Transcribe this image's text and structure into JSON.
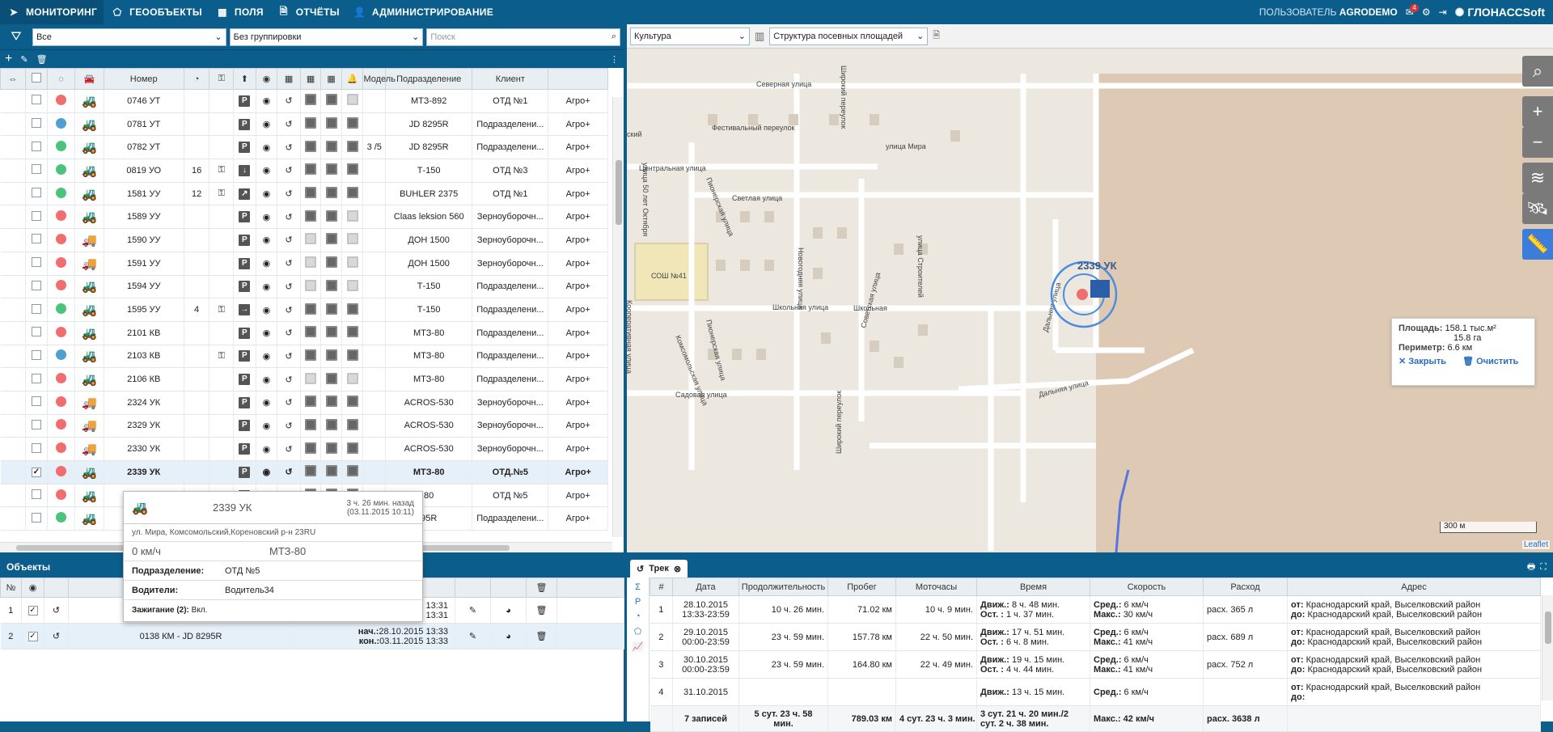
{
  "nav": {
    "items": [
      {
        "label": "МОНИТОРИНГ",
        "icon": "navigation-arrow-icon",
        "active": true
      },
      {
        "label": "ГЕООБЪЕКТЫ",
        "icon": "pentagon-icon"
      },
      {
        "label": "ПОЛЯ",
        "icon": "grid-icon"
      },
      {
        "label": "ОТЧЁТЫ",
        "icon": "document-icon"
      },
      {
        "label": "АДМИНИСТРИРОВАНИЕ",
        "icon": "user-admin-icon"
      }
    ],
    "user_prefix": "ПОЛЬЗОВАТЕЛЬ",
    "user_name": "AGRODEMO",
    "mail_badge": "4",
    "logo": "ГЛОНАССSoft"
  },
  "filters": {
    "status": "Все",
    "grouping": "Без группировки",
    "search_placeholder": "Поиск"
  },
  "columns": {
    "number": "Номер",
    "model": "Модель",
    "division": "Подразделение",
    "client": "Клиент"
  },
  "vehicles": [
    {
      "check": "",
      "color": "#f26d6d",
      "num": "0746 УТ",
      "speed": "",
      "key": "",
      "dir": "P",
      "eye": true,
      "s1": "d",
      "s2": "d",
      "s3": "l",
      "extra": "",
      "model": "МТЗ-892",
      "div": "ОТД №1",
      "client": "Агро+",
      "type": "tractor"
    },
    {
      "check": "",
      "color": "#4f9fd1",
      "num": "0781 УТ",
      "speed": "",
      "key": "",
      "dir": "P",
      "eye": true,
      "s1": "d",
      "s2": "d",
      "s3": "d",
      "extra": "",
      "model": "JD 8295R",
      "div": "Подразделени...",
      "client": "Агро+",
      "type": "tractor"
    },
    {
      "check": "",
      "color": "#4cc37b",
      "num": "0782 УТ",
      "speed": "",
      "key": "",
      "dir": "P",
      "eye": true,
      "s1": "d",
      "s2": "d",
      "s3": "d",
      "extra": "3 /5",
      "model": "JD 8295R",
      "div": "Подразделени...",
      "client": "Агро+",
      "type": "tractor"
    },
    {
      "check": "",
      "color": "#4cc37b",
      "num": "0819 УО",
      "speed": "16",
      "key": "k",
      "dir": "↓",
      "eye": true,
      "s1": "d",
      "s2": "d",
      "s3": "d",
      "extra": "",
      "model": "Т-150",
      "div": "ОТД №3",
      "client": "Агро+",
      "type": "tractor"
    },
    {
      "check": "",
      "color": "#4cc37b",
      "num": "1581 УУ",
      "speed": "12",
      "key": "k",
      "dir": "↗",
      "eye": true,
      "s1": "d",
      "s2": "d",
      "s3": "d",
      "extra": "",
      "model": "BUHLER 2375",
      "div": "ОТД №1",
      "client": "Агро+",
      "type": "tractor"
    },
    {
      "check": "",
      "color": "#f26d6d",
      "num": "1589 УУ",
      "speed": "",
      "key": "",
      "dir": "P",
      "eye": true,
      "s1": "d",
      "s2": "d",
      "s3": "l",
      "extra": "",
      "model": "Claas leksion 560",
      "div": "Зерноуборочн...",
      "client": "Агро+",
      "type": "combine"
    },
    {
      "check": "",
      "color": "#f26d6d",
      "num": "1590 УУ",
      "speed": "",
      "key": "",
      "dir": "P",
      "eye": true,
      "s1": "l",
      "s2": "d",
      "s3": "l",
      "extra": "",
      "model": "ДОН 1500",
      "div": "Зерноуборочн...",
      "client": "Агро+",
      "type": "truck"
    },
    {
      "check": "",
      "color": "#f26d6d",
      "num": "1591 УУ",
      "speed": "",
      "key": "",
      "dir": "P",
      "eye": true,
      "s1": "l",
      "s2": "d",
      "s3": "l",
      "extra": "",
      "model": "ДОН 1500",
      "div": "Зерноуборочн...",
      "client": "Агро+",
      "type": "truck"
    },
    {
      "check": "",
      "color": "#f26d6d",
      "num": "1594 УУ",
      "speed": "",
      "key": "",
      "dir": "P",
      "eye": true,
      "s1": "l",
      "s2": "d",
      "s3": "l",
      "extra": "",
      "model": "Т-150",
      "div": "Подразделени...",
      "client": "Агро+",
      "type": "tractor"
    },
    {
      "check": "",
      "color": "#4cc37b",
      "num": "1595 УУ",
      "speed": "4",
      "key": "k",
      "dir": "→",
      "eye": true,
      "s1": "d",
      "s2": "d",
      "s3": "d",
      "extra": "",
      "model": "Т-150",
      "div": "Подразделени...",
      "client": "Агро+",
      "type": "tractor"
    },
    {
      "check": "",
      "color": "#f26d6d",
      "num": "2101 КВ",
      "speed": "",
      "key": "",
      "dir": "P",
      "eye": true,
      "s1": "d",
      "s2": "d",
      "s3": "d",
      "extra": "",
      "model": "МТЗ-80",
      "div": "Подразделени...",
      "client": "Агро+",
      "type": "tractor2"
    },
    {
      "check": "",
      "color": "#4f9fd1",
      "num": "2103 КВ",
      "speed": "",
      "key": "k",
      "dir": "P",
      "eye": true,
      "s1": "d",
      "s2": "d",
      "s3": "d",
      "extra": "",
      "model": "МТЗ-80",
      "div": "Подразделени...",
      "client": "Агро+",
      "type": "tractor2"
    },
    {
      "check": "",
      "color": "#f26d6d",
      "num": "2106 КВ",
      "speed": "",
      "key": "",
      "dir": "P",
      "eye": true,
      "s1": "l",
      "s2": "d",
      "s3": "l",
      "extra": "",
      "model": "МТЗ-80",
      "div": "Подразделени...",
      "client": "Агро+",
      "type": "tractor2"
    },
    {
      "check": "",
      "color": "#f26d6d",
      "num": "2324 УК",
      "speed": "",
      "key": "",
      "dir": "P",
      "eye": true,
      "s1": "d",
      "s2": "d",
      "s3": "d",
      "extra": "",
      "model": "ACROS-530",
      "div": "Зерноуборочн...",
      "client": "Агро+",
      "type": "truck"
    },
    {
      "check": "",
      "color": "#f26d6d",
      "num": "2329 УК",
      "speed": "",
      "key": "",
      "dir": "P",
      "eye": true,
      "s1": "d",
      "s2": "d",
      "s3": "d",
      "extra": "",
      "model": "ACROS-530",
      "div": "Зерноуборочн...",
      "client": "Агро+",
      "type": "truck"
    },
    {
      "check": "",
      "color": "#f26d6d",
      "num": "2330 УК",
      "speed": "",
      "key": "",
      "dir": "P",
      "eye": true,
      "s1": "d",
      "s2": "d",
      "s3": "d",
      "extra": "",
      "model": "ACROS-530",
      "div": "Зерноуборочн...",
      "client": "Агро+",
      "type": "truck"
    },
    {
      "check": "✓",
      "color": "#f26d6d",
      "num": "2339 УК",
      "speed": "",
      "key": "",
      "dir": "P",
      "eye": true,
      "s1": "d",
      "s2": "d",
      "s3": "d",
      "extra": "",
      "model": "МТЗ-80",
      "div": "ОТД.№5",
      "client": "Агро+",
      "type": "tractor2",
      "selected": true
    },
    {
      "check": "",
      "color": "#f26d6d",
      "num": "2",
      "speed": "",
      "key": "",
      "dir": "P",
      "eye": true,
      "s1": "d",
      "s2": "d",
      "s3": "d",
      "extra": "",
      "model": "80",
      "div": "ОТД №5",
      "client": "Агро+",
      "type": "tractor2"
    },
    {
      "check": "",
      "color": "#4cc37b",
      "num": "2",
      "speed": "",
      "key": "",
      "dir": "P",
      "eye": true,
      "s1": "d",
      "s2": "d",
      "s3": "d",
      "extra": "",
      "model": "95R",
      "div": "Подразделени...",
      "client": "Агро+",
      "type": "tractor"
    }
  ],
  "tooltip": {
    "title": "2339 УК",
    "time_ago": "3 ч. 26 мин. назад",
    "time_stamp": "(03.11.2015 10:11)",
    "address": "ул. Мира, Комсомольский,Кореновский р-н 23RU",
    "speed": "0 км/ч",
    "model": "МТЗ-80",
    "division_label": "Подразделение:",
    "division": "ОТД №5",
    "drivers_label": "Водители:",
    "drivers": "Водитель34",
    "ignition_label": "Зажигание (2):",
    "ignition": "Вкл."
  },
  "objects": {
    "title": "Объекты",
    "col_num": "№",
    "col_period": "ериода",
    "rows": [
      {
        "n": "1",
        "name": "",
        "start": "5 13:31",
        "end": "5 13:31"
      },
      {
        "n": "2",
        "name": "0138 КМ - JD 8295R",
        "start_label": "нач.:",
        "start": "28.10.2015 13:33",
        "end_label": "кон.:",
        "end": "03.11.2015 13:33"
      }
    ]
  },
  "map": {
    "layer": "Культура",
    "structure": "Структура посевных площадей",
    "vehicle_label": "2339 УК",
    "scale": "300 м",
    "attribution": "Leaflet",
    "streets": [
      "Северная улица",
      "Фестивальный переулок",
      "улица Мира",
      "Центральная улица",
      "Светлая улица",
      "Школьная улица",
      "Садовая улица",
      "Дальняя улица",
      "СОШ №41",
      "ский",
      "Широкий переулок",
      "Пионерская улица",
      "улица 50 лет Октября",
      "Новогодняя улица",
      "улица Строителей",
      "Комсомольская улица",
      "Советская улица",
      "Пионерская улица",
      "Широкий переулок",
      "Кооперативная улица",
      "Школьная",
      "Дальняя улица"
    ],
    "measure": {
      "area_label": "Площадь:",
      "area1": "158.1 тыс.м²",
      "area2": "15.8 га",
      "perimeter_label": "Периметр:",
      "perimeter": "6.6 км",
      "close": "Закрыть",
      "clear": "Очистить"
    }
  },
  "track": {
    "tab": "Трек",
    "cols": [
      "#",
      "Дата",
      "Продолжительность",
      "Пробег",
      "Моточасы",
      "Время",
      "Скорость",
      "Расход",
      "Адрес"
    ],
    "rows": [
      {
        "n": "1",
        "d1": "28.10.2015",
        "d2": "13:33-23:59",
        "dur": "10 ч. 26 мин.",
        "run": "71.02 км",
        "moto": "10 ч. 9 мин.",
        "t1l": "Движ.:",
        "t1": "8 ч. 48 мин.",
        "t2l": "Ост. :",
        "t2": "1 ч. 37 мин.",
        "s1l": "Сред.:",
        "s1": "6 км/ч",
        "s2l": "Макс.:",
        "s2": "30 км/ч",
        "fuel": "расх. 365 л",
        "a1": "Краснодарский край, Выселковский район",
        "a2": "Краснодарский край, Выселковский район"
      },
      {
        "n": "2",
        "d1": "29.10.2015",
        "d2": "00:00-23:59",
        "dur": "23 ч. 59 мин.",
        "run": "157.78 км",
        "moto": "22 ч. 50 мин.",
        "t1l": "Движ.:",
        "t1": "17 ч. 51 мин.",
        "t2l": "Ост. :",
        "t2": "6 ч. 8 мин.",
        "s1l": "Сред.:",
        "s1": "6 км/ч",
        "s2l": "Макс.:",
        "s2": "41 км/ч",
        "fuel": "расх. 689 л",
        "a1": "Краснодарский край, Выселковский район",
        "a2": "Краснодарский край, Выселковский район"
      },
      {
        "n": "3",
        "d1": "30.10.2015",
        "d2": "00:00-23:59",
        "dur": "23 ч. 59 мин.",
        "run": "164.80 км",
        "moto": "22 ч. 49 мин.",
        "t1l": "Движ.:",
        "t1": "19 ч. 15 мин.",
        "t2l": "Ост. :",
        "t2": "4 ч. 44 мин.",
        "s1l": "Сред.:",
        "s1": "6 км/ч",
        "s2l": "Макс.:",
        "s2": "41 км/ч",
        "fuel": "расх. 752 л",
        "a1": "Краснодарский край, Выселковский район",
        "a2": "Краснодарский край, Выселковский район"
      },
      {
        "n": "4",
        "d1": "31.10.2015",
        "d2": "",
        "dur": "",
        "run": "",
        "moto": "",
        "t1l": "Движ.:",
        "t1": "13 ч. 15 мин.",
        "t2l": "",
        "t2": "",
        "s1l": "Сред.:",
        "s1": "6 км/ч",
        "s2l": "",
        "s2": "",
        "fuel": "",
        "a1": "Краснодарский край, Выселковский район",
        "a2": ""
      }
    ],
    "addr_from": "от:",
    "addr_to": "до:",
    "footer": {
      "count": "7 записей",
      "dur1": "5 сут. 23 ч. 58",
      "dur2": "мин.",
      "run": "789.03 км",
      "moto": "4 сут. 23 ч. 3 мин.",
      "t1": "3 сут. 21 ч. 20 мин./2",
      "t2": "сут. 2 ч. 38 мин.",
      "speed": "Макс.: 42 км/ч",
      "fuel": "расх. 3638 л"
    }
  }
}
